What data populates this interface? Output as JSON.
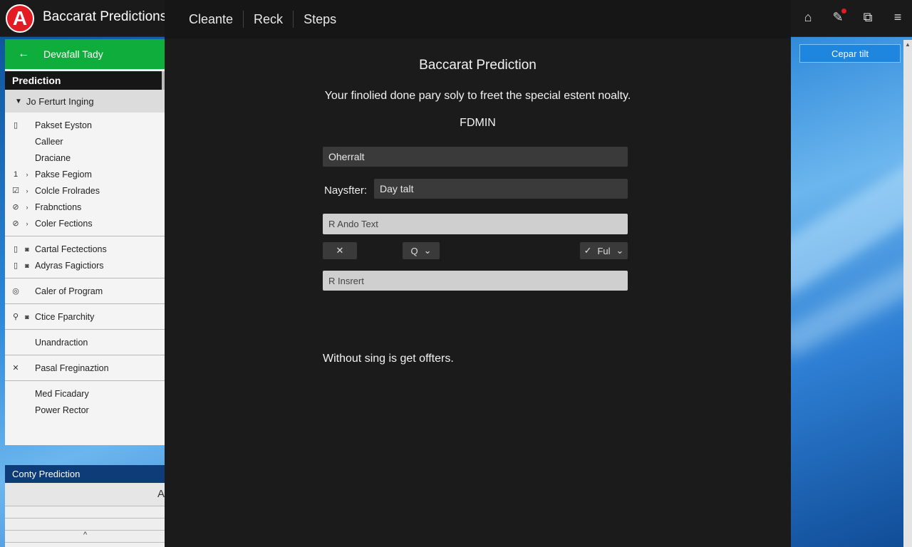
{
  "app": {
    "logo_letter": "A",
    "title": "Baccarat Predictions"
  },
  "tabs": [
    "Cleante",
    "Reck",
    "Steps"
  ],
  "top_icons": [
    "home-icon",
    "pen-icon",
    "share-icon",
    "menu-icon"
  ],
  "sidebar": {
    "back_label": "Devafall Tady",
    "section_title": "Prediction",
    "group_label": "Jo Ferturt Inging",
    "block1": [
      {
        "icon": "▯",
        "label": "Pakset Eyston"
      },
      {
        "icon": "",
        "label": "Calleer"
      },
      {
        "icon": "",
        "label": "Draciane"
      },
      {
        "icon": "1",
        "sub": "›",
        "label": "Pakse Fegiom"
      },
      {
        "icon": "☑",
        "sub": "›",
        "label": "Colcle Frolrades"
      },
      {
        "icon": "⊘",
        "sub": "›",
        "label": "Frabnctions"
      },
      {
        "icon": "⊘",
        "sub": "›",
        "label": "Coler Fections"
      }
    ],
    "block2": [
      {
        "icon": "▯",
        "sub": "◙",
        "label": "Cartal Fectections"
      },
      {
        "icon": "▯",
        "sub": "◙",
        "label": "Adyras Fagictiors"
      }
    ],
    "block3": [
      {
        "icon": "◎",
        "label": "Caler of Program"
      }
    ],
    "block4": [
      {
        "icon": "⚲",
        "sub": "◙",
        "label": "Ctice Fparchity"
      }
    ],
    "block5": [
      {
        "icon": "",
        "label": "Unandraction"
      }
    ],
    "block6": [
      {
        "icon": "✕",
        "label": "Pasal Freginaztion"
      }
    ],
    "block7": [
      {
        "icon": "",
        "label": "Med Ficadary"
      },
      {
        "icon": "",
        "label": "Power Rector"
      }
    ]
  },
  "sidebar_bottom": {
    "title": "Conty Prediction",
    "row1": "A",
    "row4": "^"
  },
  "dialog": {
    "title": "Baccarat Prediction",
    "description": "Your finolied done pary soly to freet the special estent noalty.",
    "subtitle": "FDMIN",
    "field1_value": "Oherralt",
    "field2_label": "Naysfter:",
    "field2_value": "Day talt",
    "field3_value": "R Ando Text",
    "ctl1": "✕",
    "ctl2": "Q",
    "ctl3_check": "✓",
    "ctl3": "Ful",
    "field4_value": "R Insrert",
    "footer": "Without sing is get offters."
  },
  "right_panel": {
    "button_label": "Cepar tilt"
  }
}
